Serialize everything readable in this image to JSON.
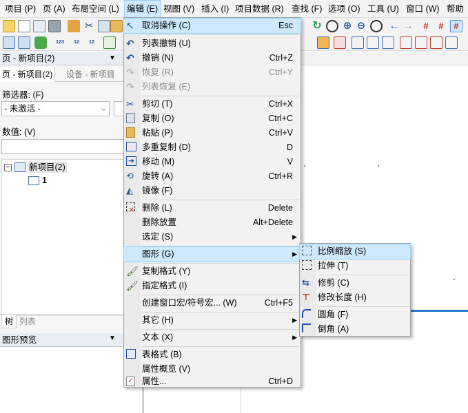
{
  "menubar": [
    {
      "label": "项目 (P)"
    },
    {
      "label": "页 (A)"
    },
    {
      "label": "布局空间 (L)"
    },
    {
      "label": "编辑 (E)"
    },
    {
      "label": "视图 (V)"
    },
    {
      "label": "插入 (I)"
    },
    {
      "label": "项目数据 (R)"
    },
    {
      "label": "查找 (F)"
    },
    {
      "label": "选项 (O)"
    },
    {
      "label": "工具 (U)"
    },
    {
      "label": "窗口 (W)"
    },
    {
      "label": "帮助"
    }
  ],
  "left_panel": {
    "title": "页 - 新项目(2)",
    "tabs": [
      "页 - 新项目(2)",
      "设备 - 新项目"
    ],
    "filter_label": "筛选器: (F)",
    "filter_value": "- 未激活 -",
    "value_label": "数值: (V)",
    "value_input": "",
    "tree_root": "新项目(2)",
    "tree_child": "1",
    "bottom_tabs": [
      "树",
      "列表"
    ],
    "preview_title": "图形预览"
  },
  "edit_menu": {
    "items": [
      {
        "label": "取消操作 (C)",
        "shortcut": "Esc"
      },
      {
        "label": "列表撤销 (U)",
        "shortcut": ""
      },
      {
        "label": "撤销 (N)",
        "shortcut": "Ctrl+Z"
      },
      {
        "label": "恢复 (R)",
        "shortcut": "Ctrl+Y"
      },
      {
        "label": "列表恢复 (E)",
        "shortcut": ""
      },
      {
        "label": "剪切 (T)",
        "shortcut": "Ctrl+X"
      },
      {
        "label": "复制 (O)",
        "shortcut": "Ctrl+C"
      },
      {
        "label": "粘贴 (P)",
        "shortcut": "Ctrl+V"
      },
      {
        "label": "多重复制 (D)",
        "shortcut": "D"
      },
      {
        "label": "移动 (M)",
        "shortcut": "V"
      },
      {
        "label": "旋转 (A)",
        "shortcut": "Ctrl+R"
      },
      {
        "label": "镜像 (F)",
        "shortcut": ""
      },
      {
        "label": "删除 (L)",
        "shortcut": "Delete"
      },
      {
        "label": "删除放置",
        "shortcut": "Alt+Delete"
      },
      {
        "label": "选定 (S)",
        "shortcut": ""
      },
      {
        "label": "图形 (G)",
        "shortcut": ""
      },
      {
        "label": "复制格式 (Y)",
        "shortcut": ""
      },
      {
        "label": "指定格式 (I)",
        "shortcut": ""
      },
      {
        "label": "创建窗口宏/符号宏... (W)",
        "shortcut": "Ctrl+F5"
      },
      {
        "label": "其它 (H)",
        "shortcut": ""
      },
      {
        "label": "文本 (X)",
        "shortcut": ""
      },
      {
        "label": "表格式 (B)",
        "shortcut": ""
      },
      {
        "label": "属性概览 (V)",
        "shortcut": ""
      },
      {
        "label": "属性...",
        "shortcut": "Ctrl+D"
      }
    ]
  },
  "graphic_submenu": {
    "items": [
      {
        "label": "比例缩放 (S)"
      },
      {
        "label": "拉伸 (T)"
      },
      {
        "label": "修剪 (C)"
      },
      {
        "label": "修改长度 (H)"
      },
      {
        "label": "圆角 (F)"
      },
      {
        "label": "倒角 (A)"
      }
    ]
  },
  "colors": {
    "highlight": "#cde8ff",
    "accent_blue": "#1f6fc9",
    "canvas_line": "#2477c9"
  }
}
